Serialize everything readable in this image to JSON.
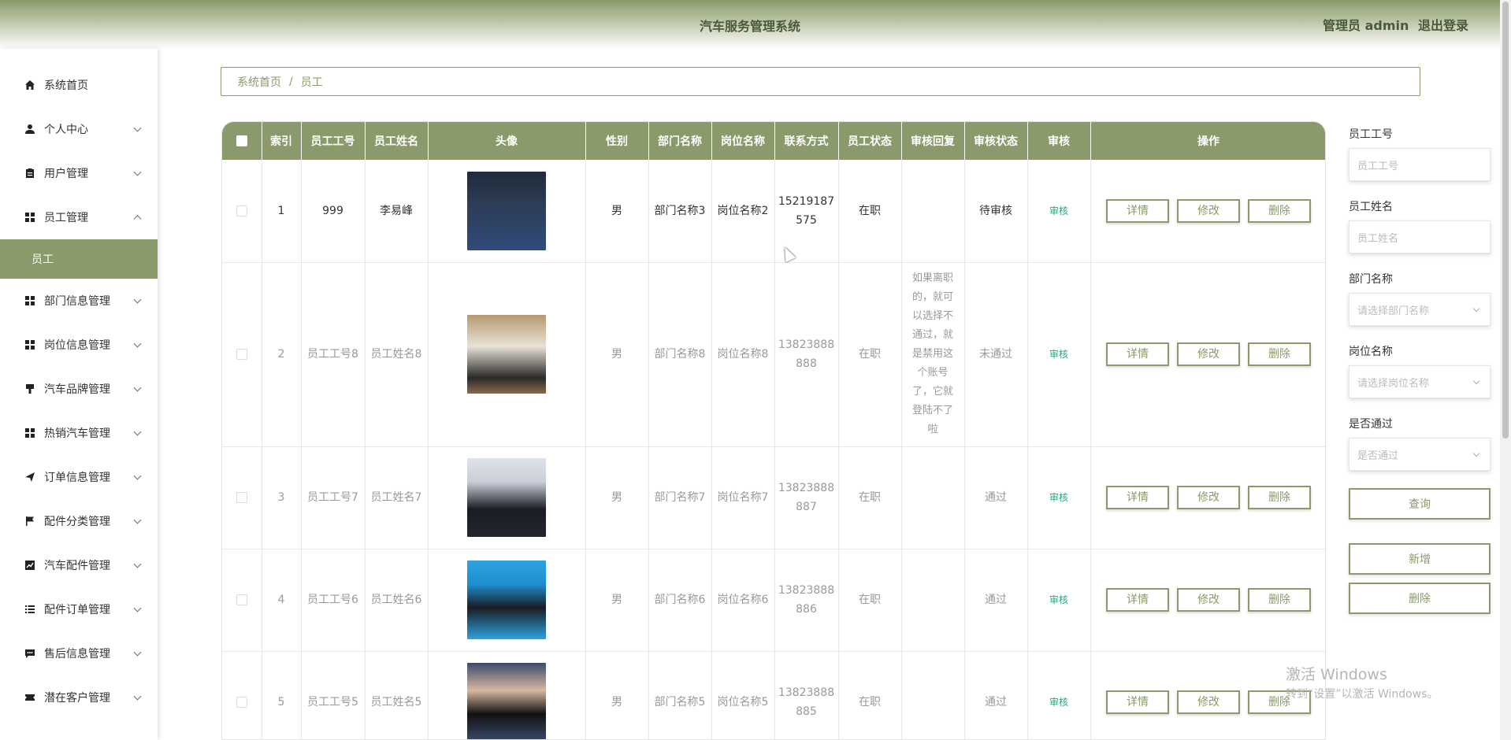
{
  "header": {
    "title": "汽车服务管理系统",
    "user_label": "管理员 admin",
    "logout_label": "退出登录"
  },
  "sidebar": {
    "items": [
      {
        "label": "系统首页",
        "icon": "home-icon",
        "expandable": false
      },
      {
        "label": "个人中心",
        "icon": "user-icon",
        "expandable": true
      },
      {
        "label": "用户管理",
        "icon": "clipboard-icon",
        "expandable": true
      },
      {
        "label": "员工管理",
        "icon": "grid-icon",
        "expandable": true,
        "expanded": true
      },
      {
        "label": "员工",
        "icon": "",
        "sub": true,
        "active": true
      },
      {
        "label": "部门信息管理",
        "icon": "grid-icon",
        "expandable": true
      },
      {
        "label": "岗位信息管理",
        "icon": "grid-icon",
        "expandable": true
      },
      {
        "label": "汽车品牌管理",
        "icon": "brush-icon",
        "expandable": true
      },
      {
        "label": "热销汽车管理",
        "icon": "grid-icon",
        "expandable": true
      },
      {
        "label": "订单信息管理",
        "icon": "send-icon",
        "expandable": true
      },
      {
        "label": "配件分类管理",
        "icon": "flag-icon",
        "expandable": true
      },
      {
        "label": "汽车配件管理",
        "icon": "chart-icon",
        "expandable": true
      },
      {
        "label": "配件订单管理",
        "icon": "list-icon",
        "expandable": true
      },
      {
        "label": "售后信息管理",
        "icon": "chat-icon",
        "expandable": true
      },
      {
        "label": "潜在客户管理",
        "icon": "ticket-icon",
        "expandable": true
      }
    ]
  },
  "breadcrumb": {
    "home": "系统首页",
    "sep": "/",
    "current": "员工"
  },
  "table": {
    "headers": [
      "",
      "索引",
      "员工工号",
      "员工姓名",
      "头像",
      "性别",
      "部门名称",
      "岗位名称",
      "联系方式",
      "员工状态",
      "审核回复",
      "审核状态",
      "审核",
      "操作"
    ],
    "rows": [
      {
        "index": "1",
        "emp_no": "999",
        "name": "李易峰",
        "gender": "男",
        "dept": "部门名称3",
        "post": "岗位名称2",
        "phone": "15219187575",
        "status": "在职",
        "reply": "",
        "audit_status": "待审核",
        "audit": "审核"
      },
      {
        "index": "2",
        "emp_no": "员工工号8",
        "name": "员工姓名8",
        "gender": "男",
        "dept": "部门名称8",
        "post": "岗位名称8",
        "phone": "13823888888",
        "status": "在职",
        "reply": "如果离职的，就可以选择不通过，就是禁用这个账号了，它就登陆不了啦",
        "audit_status": "未通过",
        "audit": "审核"
      },
      {
        "index": "3",
        "emp_no": "员工工号7",
        "name": "员工姓名7",
        "gender": "男",
        "dept": "部门名称7",
        "post": "岗位名称7",
        "phone": "13823888887",
        "status": "在职",
        "reply": "",
        "audit_status": "通过",
        "audit": "审核"
      },
      {
        "index": "4",
        "emp_no": "员工工号6",
        "name": "员工姓名6",
        "gender": "男",
        "dept": "部门名称6",
        "post": "岗位名称6",
        "phone": "13823888886",
        "status": "在职",
        "reply": "",
        "audit_status": "通过",
        "audit": "审核"
      },
      {
        "index": "5",
        "emp_no": "员工工号5",
        "name": "员工姓名5",
        "gender": "男",
        "dept": "部门名称5",
        "post": "岗位名称5",
        "phone": "13823888885",
        "status": "在职",
        "reply": "",
        "audit_status": "通过",
        "audit": "审核"
      }
    ],
    "actions": {
      "detail": "详情",
      "edit": "修改",
      "delete": "删除"
    }
  },
  "search": {
    "emp_no_label": "员工工号",
    "emp_no_placeholder": "员工工号",
    "name_label": "员工姓名",
    "name_placeholder": "员工姓名",
    "dept_label": "部门名称",
    "dept_placeholder": "请选择部门名称",
    "post_label": "岗位名称",
    "post_placeholder": "请选择岗位名称",
    "pass_label": "是否通过",
    "pass_placeholder": "是否通过",
    "query_button": "查询",
    "add_button": "新增",
    "delete_button": "删除"
  },
  "watermark": {
    "line1": "激活 Windows",
    "line2": "转到“设置”以激活 Windows。"
  },
  "colors": {
    "accent": "#8a9a6a",
    "audit_link": "#2aa57a"
  }
}
